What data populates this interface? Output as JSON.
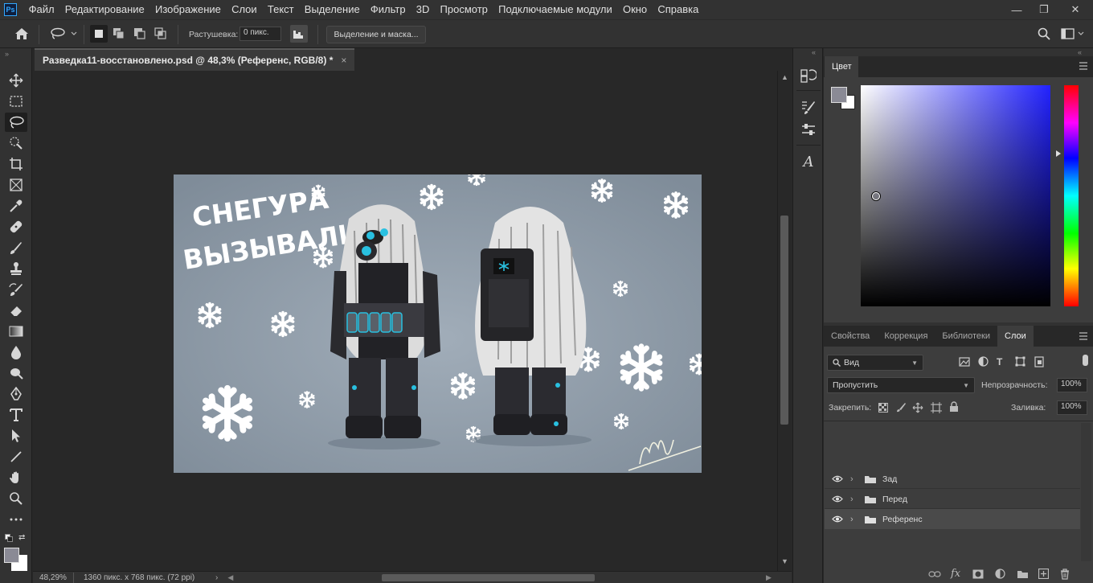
{
  "app": {
    "logo": "Ps"
  },
  "menu": [
    "Файл",
    "Редактирование",
    "Изображение",
    "Слои",
    "Текст",
    "Выделение",
    "Фильтр",
    "3D",
    "Просмотр",
    "Подключаемые модули",
    "Окно",
    "Справка"
  ],
  "window_controls": {
    "minimize": "—",
    "restore": "❐",
    "close": "✕"
  },
  "options": {
    "feather_label": "Растушевка:",
    "feather_value": "0 пикс.",
    "select_mask_button": "Выделение и маска..."
  },
  "document": {
    "tab_title": "Разведка11-восстановлено.psd @ 48,3% (Референс, RGB/8) *",
    "close_glyph": "×",
    "zoom": "48,29%",
    "doc_info": "1360 пикс. x 768 пикс. (72 ppi)"
  },
  "artwork": {
    "headline_line1": "СНЕГУРА",
    "headline_line2": "ВЫЗЫВАЛИ?",
    "background_color": "#8a97a4"
  },
  "color_panel": {
    "tab": "Цвет",
    "foreground": "#8a8a95",
    "background": "#ffffff",
    "hue_color": "#2222ff"
  },
  "layers_panel": {
    "tabs": [
      "Свойства",
      "Коррекция",
      "Библиотеки",
      "Слои"
    ],
    "active_tab": 3,
    "filter_label": "Вид",
    "blend_mode": "Пропустить",
    "opacity_label": "Непрозрачность:",
    "opacity_value": "100%",
    "lock_label": "Закрепить:",
    "fill_label": "Заливка:",
    "fill_value": "100%",
    "layers": [
      {
        "name": "Зад",
        "selected": false
      },
      {
        "name": "Перед",
        "selected": false
      },
      {
        "name": "Референс",
        "selected": true
      }
    ]
  },
  "colors": {
    "accent": "#31a8ff",
    "chrome": "#323232",
    "canvas_bg": "#282828"
  }
}
